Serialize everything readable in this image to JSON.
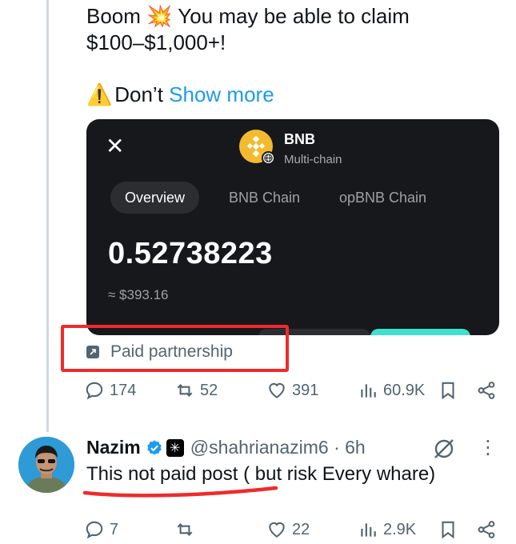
{
  "post": {
    "line1": "Boom 💥 You may be able to claim",
    "line2": "$100–$1,000+!",
    "warning_emoji": "⚠️",
    "line3_text": "Don’t",
    "show_more": "Show more"
  },
  "card": {
    "close_icon": "close-icon",
    "coin_name": "BNB",
    "coin_sub": "Multi-chain",
    "tabs": [
      "Overview",
      "BNB Chain",
      "opBNB Chain"
    ],
    "active_tab": "Overview",
    "amount": "0.52738223",
    "fiat": "≈ $393.16",
    "accent_color": "#40e0d0",
    "coin_color": "#f3ba2f"
  },
  "paid_partnership": "Paid partnership",
  "post_actions": {
    "replies": "174",
    "reposts": "52",
    "likes": "391",
    "views": "60.9K"
  },
  "reply": {
    "name": "Nazim",
    "handle": "@shahrianazim6 · 6h",
    "text": "This not paid post ( but risk Every whare)",
    "actions": {
      "replies": "7",
      "reposts": "",
      "likes": "22",
      "views": "2.9K"
    }
  },
  "colors": {
    "highlight": "#ee2b2b",
    "link": "#1d9bf0",
    "verified": "#1d9bf0"
  }
}
